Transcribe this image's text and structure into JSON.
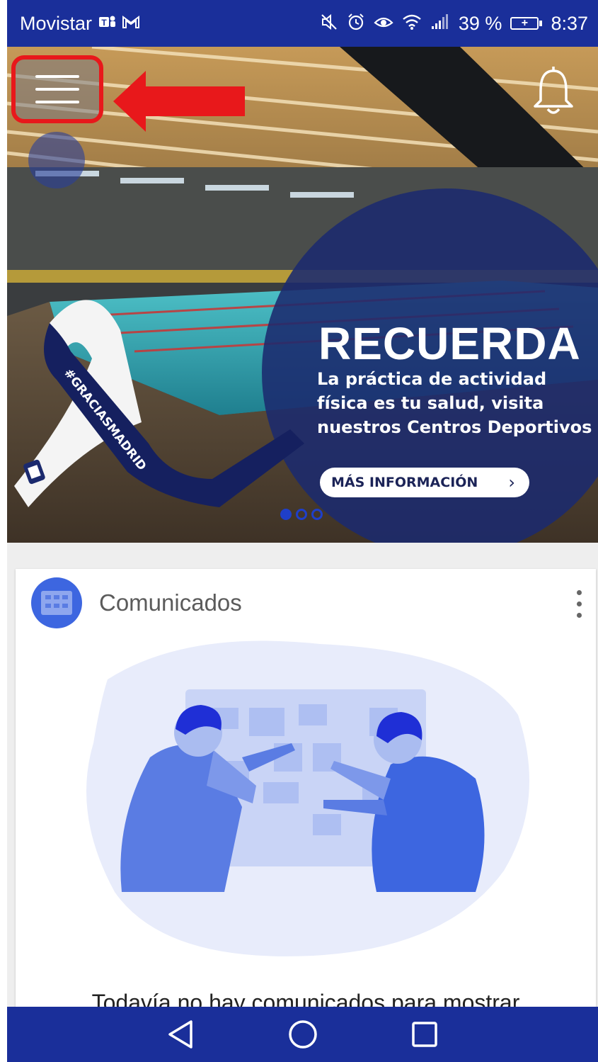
{
  "status_bar": {
    "carrier": "Movistar",
    "battery_percent": "39 %",
    "time": "8:37",
    "icons": [
      "teams-icon",
      "gmail-icon",
      "mute-icon",
      "alarm-icon",
      "eye-comfort-icon",
      "wifi-icon",
      "signal-icon",
      "battery-charging-icon"
    ]
  },
  "banner": {
    "title": "RECUERDA",
    "body": "La práctica de actividad física es tu salud, visita nuestros Centros Deportivos",
    "ribbon_text": "#GRACIASMADRID",
    "button_label": "MÁS INFORMACIÓN",
    "slides_total": 3,
    "slide_active": 1
  },
  "card": {
    "title": "Comunicados",
    "empty_message": "Todavía no hay comunicados para mostrar"
  },
  "colors": {
    "primary": "#1a2f9a",
    "highlight": "#e8181b",
    "illustration": "#3d66e0"
  }
}
